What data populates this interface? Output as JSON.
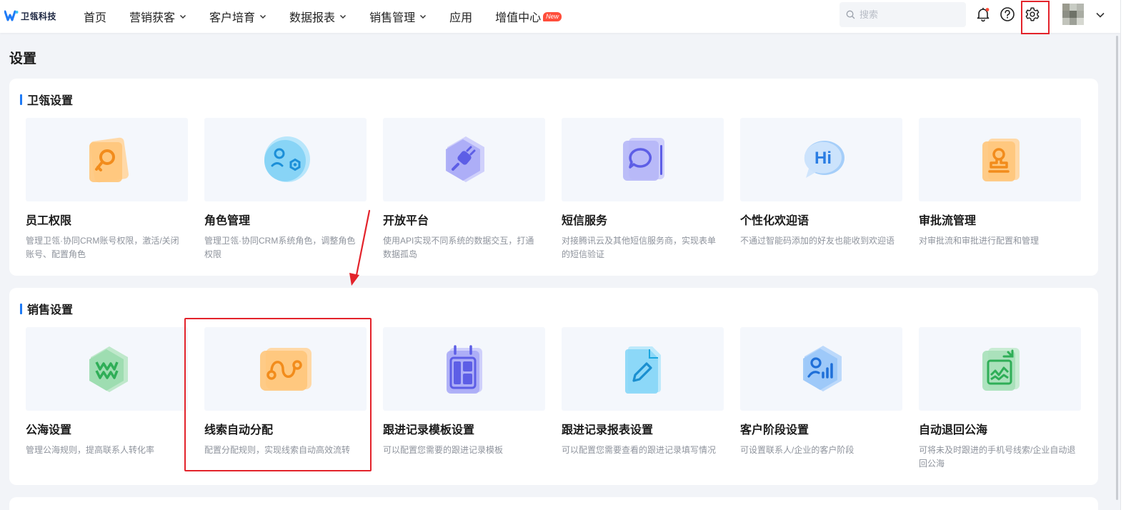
{
  "brand": {
    "name": "卫瓴科技"
  },
  "nav": [
    {
      "label": "首页",
      "has_dropdown": false,
      "badge": ""
    },
    {
      "label": "营销获客",
      "has_dropdown": true,
      "badge": ""
    },
    {
      "label": "客户培育",
      "has_dropdown": true,
      "badge": ""
    },
    {
      "label": "数据报表",
      "has_dropdown": true,
      "badge": ""
    },
    {
      "label": "销售管理",
      "has_dropdown": true,
      "badge": ""
    },
    {
      "label": "应用",
      "has_dropdown": false,
      "badge": ""
    },
    {
      "label": "增值中心",
      "has_dropdown": false,
      "badge": "New"
    }
  ],
  "search": {
    "placeholder": "搜索"
  },
  "page": {
    "title": "设置"
  },
  "sections": [
    {
      "title": "卫瓴设置",
      "cards": [
        {
          "name": "员工权限",
          "desc": "管理卫瓴·协同CRM账号权限，激活/关闭账号、配置角色",
          "icon": "key-icon",
          "color": "#f7a334"
        },
        {
          "name": "角色管理",
          "desc": "管理卫瓴·协同CRM系统角色，调整角色权限",
          "icon": "role-network-icon",
          "color": "#3aa9ee"
        },
        {
          "name": "开放平台",
          "desc": "使用API实现不同系统的数据交互，打通数据孤岛",
          "icon": "plug-icon",
          "color": "#7b7cf0"
        },
        {
          "name": "短信服务",
          "desc": "对接腾讯云及其他短信服务商，实现表单的短信验证",
          "icon": "message-bubble-icon",
          "color": "#7b7cf0"
        },
        {
          "name": "个性化欢迎语",
          "desc": "不通过智能码添加的好友也能收到欢迎语",
          "icon": "hi-bubble-icon",
          "color": "#3a8ff0"
        },
        {
          "name": "审批流管理",
          "desc": "对审批流和审批进行配置和管理",
          "icon": "stamp-icon",
          "color": "#f7a334"
        }
      ]
    },
    {
      "title": "销售设置",
      "cards": [
        {
          "name": "公海设置",
          "desc": "管理公海规则，提高联系人转化率",
          "icon": "sea-waves-icon",
          "color": "#52c06f"
        },
        {
          "name": "线索自动分配",
          "desc": "配置分配规则，实现线索自动高效流转",
          "icon": "route-icon",
          "color": "#f7a334"
        },
        {
          "name": "跟进记录模板设置",
          "desc": "可以配置您需要的跟进记录模板",
          "icon": "calendar-template-icon",
          "color": "#7b7cf0"
        },
        {
          "name": "跟进记录报表设置",
          "desc": "可以配置您需要查看的跟进记录填写情况",
          "icon": "edit-document-icon",
          "color": "#36b9f0"
        },
        {
          "name": "客户阶段设置",
          "desc": "可设置联系人/企业的客户阶段",
          "icon": "user-chart-icon",
          "color": "#3a8ff0"
        },
        {
          "name": "自动退回公海",
          "desc": "可将未及时跟进的手机号线索/企业自动退回公海",
          "icon": "trend-return-icon",
          "color": "#52c06f"
        }
      ]
    }
  ],
  "colors": {
    "accent": "#1f7bf6",
    "highlight": "#e3232b",
    "badge": "#ff4d3a"
  }
}
